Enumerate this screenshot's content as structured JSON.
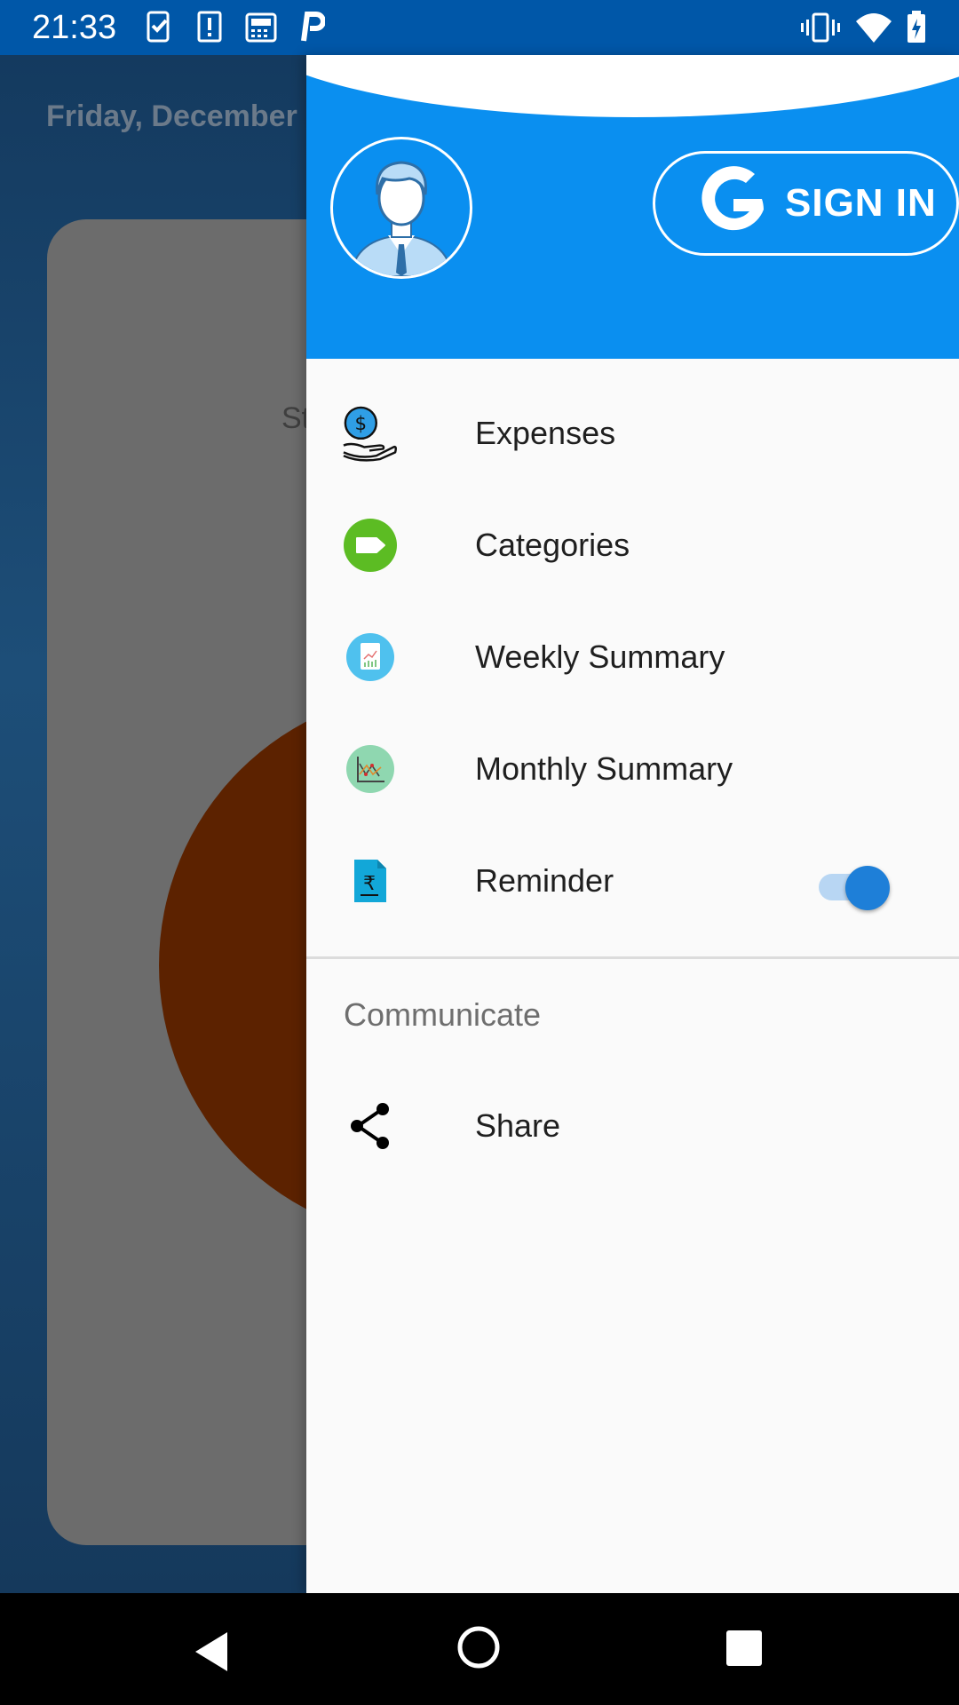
{
  "status_bar": {
    "time": "21:33",
    "icons": [
      "task-check-icon",
      "alert-icon",
      "news-icon",
      "p-app-icon",
      "vibrate-icon",
      "wifi-icon",
      "battery-charging-icon"
    ],
    "color": "#0057a8"
  },
  "background_app": {
    "date_text": "Friday, December",
    "card_text": "St"
  },
  "drawer": {
    "header_color": "#0a8ff0",
    "avatar_icon": "user-avatar-icon",
    "signin_label": "SIGN IN",
    "menu": [
      {
        "label": "Expenses",
        "icon": "expenses-icon"
      },
      {
        "label": "Categories",
        "icon": "categories-icon"
      },
      {
        "label": "Weekly Summary",
        "icon": "weekly-summary-icon"
      },
      {
        "label": "Monthly Summary",
        "icon": "monthly-summary-icon"
      },
      {
        "label": "Reminder",
        "icon": "reminder-icon",
        "toggle_on": true
      }
    ],
    "section_title": "Communicate",
    "share_label": "Share",
    "share_icon": "share-icon"
  },
  "nav_bar": {
    "buttons": [
      "back-icon",
      "home-icon",
      "recents-icon"
    ]
  }
}
